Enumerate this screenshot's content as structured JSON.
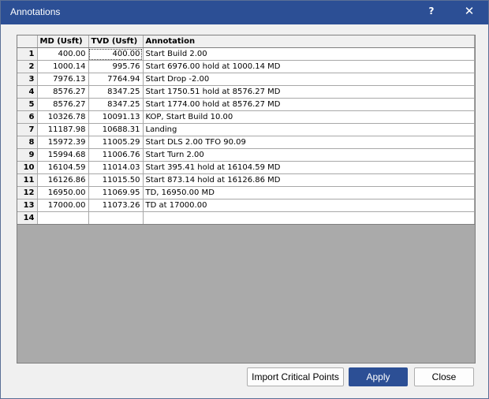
{
  "window": {
    "title": "Annotations",
    "help_glyph": "?",
    "close_glyph": "✕"
  },
  "table": {
    "columns": [
      "",
      "MD (Usft)",
      "TVD (Usft)",
      "Annotation"
    ],
    "rows": [
      {
        "n": "1",
        "md": "400.00",
        "tvd": "400.00",
        "ann": "Start Build 2.00"
      },
      {
        "n": "2",
        "md": "1000.14",
        "tvd": "995.76",
        "ann": "Start 6976.00 hold at 1000.14 MD"
      },
      {
        "n": "3",
        "md": "7976.13",
        "tvd": "7764.94",
        "ann": "Start Drop -2.00"
      },
      {
        "n": "4",
        "md": "8576.27",
        "tvd": "8347.25",
        "ann": "Start 1750.51 hold at 8576.27 MD"
      },
      {
        "n": "5",
        "md": "8576.27",
        "tvd": "8347.25",
        "ann": "Start 1774.00 hold at 8576.27 MD"
      },
      {
        "n": "6",
        "md": "10326.78",
        "tvd": "10091.13",
        "ann": "KOP, Start Build 10.00"
      },
      {
        "n": "7",
        "md": "11187.98",
        "tvd": "10688.31",
        "ann": "Landing"
      },
      {
        "n": "8",
        "md": "15972.39",
        "tvd": "11005.29",
        "ann": "Start DLS 2.00 TFO 90.09"
      },
      {
        "n": "9",
        "md": "15994.68",
        "tvd": "11006.76",
        "ann": "Start Turn 2.00"
      },
      {
        "n": "10",
        "md": "16104.59",
        "tvd": "11014.03",
        "ann": "Start 395.41 hold at 16104.59 MD"
      },
      {
        "n": "11",
        "md": "16126.86",
        "tvd": "11015.50",
        "ann": "Start 873.14 hold at 16126.86 MD"
      },
      {
        "n": "12",
        "md": "16950.00",
        "tvd": "11069.95",
        "ann": "TD, 16950.00 MD"
      },
      {
        "n": "13",
        "md": "17000.00",
        "tvd": "11073.26",
        "ann": "TD at 17000.00"
      },
      {
        "n": "14",
        "md": "",
        "tvd": "",
        "ann": ""
      }
    ]
  },
  "buttons": {
    "import_label": "Import Critical Points",
    "apply_label": "Apply",
    "close_label": "Close"
  },
  "colors": {
    "title_bar": "#2c4f95",
    "primary_button": "#2c4f95",
    "empty_grid": "#aaaaaa"
  }
}
